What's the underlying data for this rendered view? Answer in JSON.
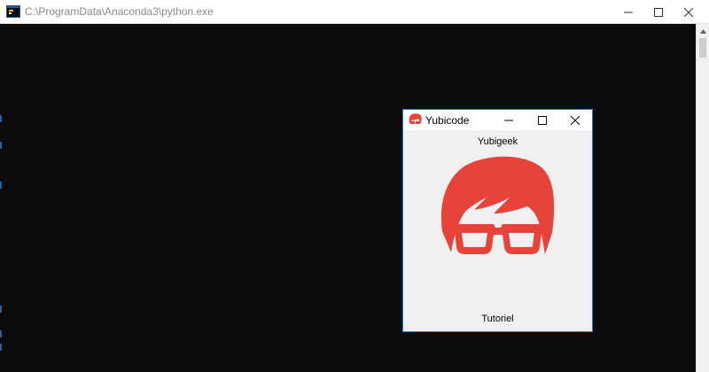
{
  "console": {
    "title": "C:\\ProgramData\\Anaconda3\\python.exe",
    "background": "#0c0c0c"
  },
  "tk_window": {
    "title": "Yubicode",
    "label_top": "Yubigeek",
    "label_bottom": "Tutoriel",
    "accent": "#e6433a",
    "frame_color": "#1f7fd5"
  },
  "icons": {
    "console": "python-console-icon",
    "app": "geek-avatar-icon",
    "minimize": "minimize-icon",
    "maximize": "maximize-icon",
    "close": "close-icon"
  }
}
